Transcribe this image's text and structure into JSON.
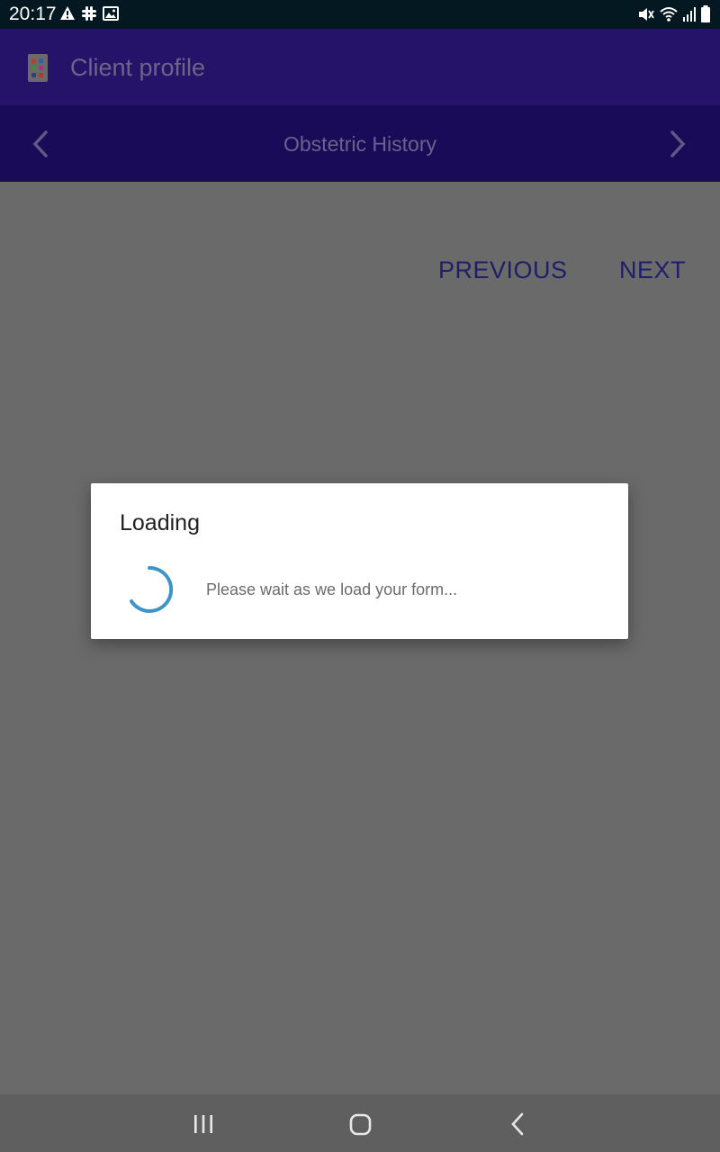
{
  "status_bar": {
    "time": "20:17",
    "left_icons": [
      "warning-icon",
      "slack-icon",
      "image-icon"
    ],
    "right_icons": [
      "mute-icon",
      "wifi-icon",
      "signal-icon",
      "battery-icon"
    ]
  },
  "app_bar": {
    "title": "Client profile",
    "logo_colors": [
      "#c0392b",
      "#2f5fa8",
      "#3a8f3a",
      "#b03080",
      "#304080",
      "#c03030"
    ]
  },
  "tab_bar": {
    "title": "Obstetric History",
    "prev_icon": "chevron-left-icon",
    "next_icon": "chevron-right-icon"
  },
  "form_nav": {
    "previous_label": "PREVIOUS",
    "next_label": "NEXT"
  },
  "dialog": {
    "title": "Loading",
    "message": "Please wait as we load your form..."
  },
  "system_nav": {
    "recents_icon": "recents-icon",
    "home_icon": "home-icon",
    "back_icon": "back-icon"
  },
  "colors": {
    "status_bar": "#031820",
    "app_bar": "#241368",
    "tab_bar": "#1a0b58",
    "overlay": "#6a6a6a",
    "button_text": "#1f1e68",
    "spinner": "#3d94c9"
  }
}
